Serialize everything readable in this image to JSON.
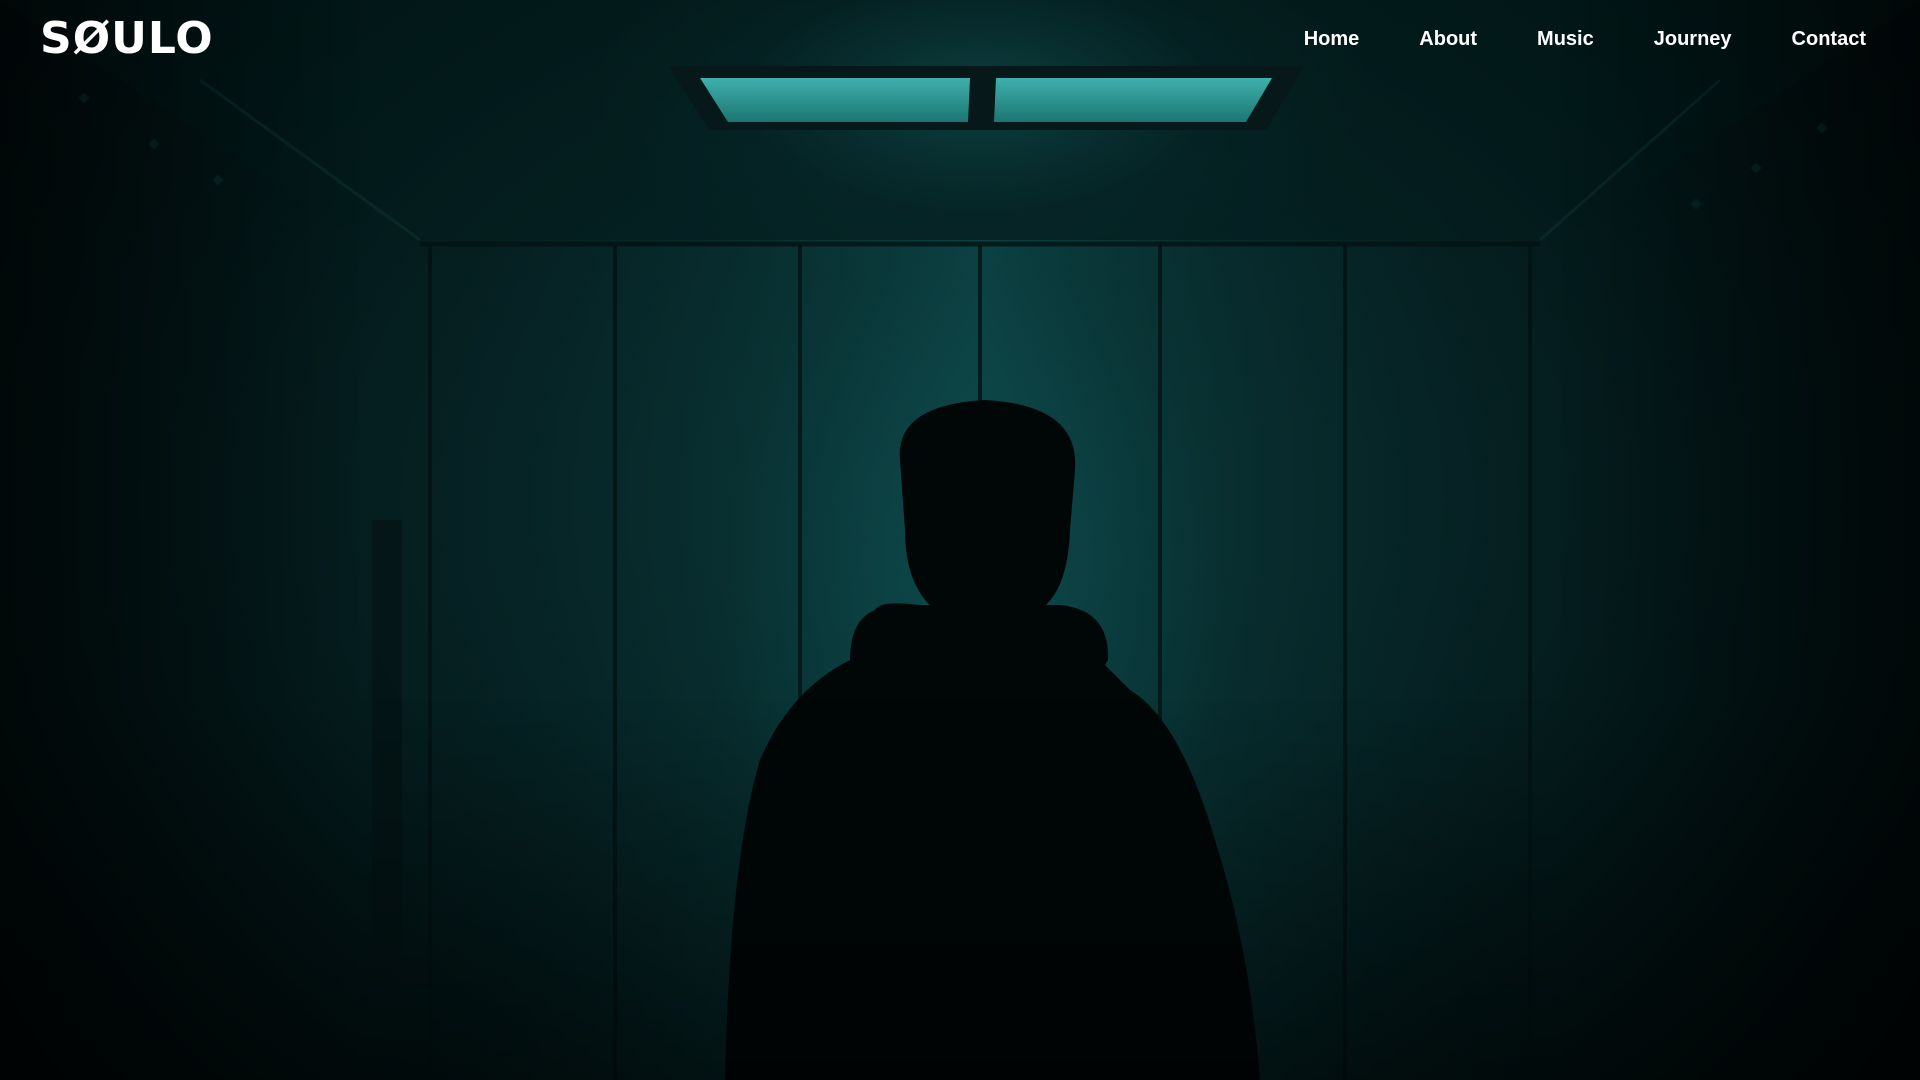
{
  "brand": {
    "logo_text": "SØULO"
  },
  "nav": {
    "items": [
      {
        "label": "Home"
      },
      {
        "label": "About"
      },
      {
        "label": "Music"
      },
      {
        "label": "Journey"
      },
      {
        "label": "Contact"
      }
    ]
  },
  "colors": {
    "text": "#ffffff",
    "background": "#031415",
    "accent_glow": "#1c7878"
  }
}
